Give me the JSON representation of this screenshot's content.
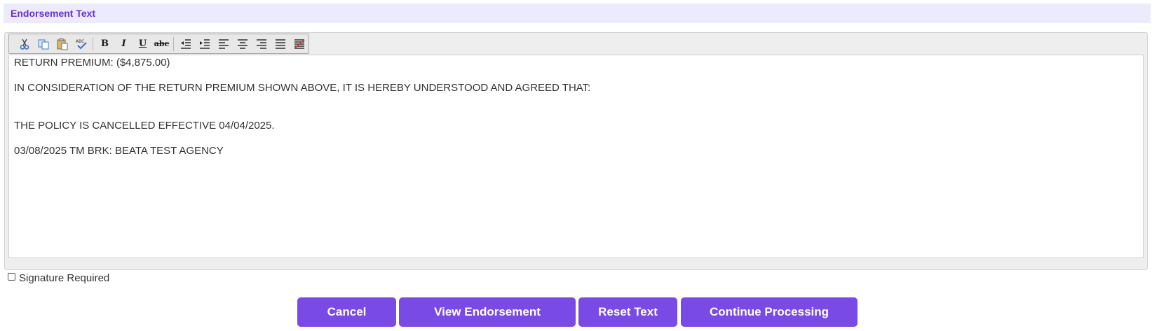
{
  "section": {
    "title": "Endorsement Text"
  },
  "toolbar": {
    "buttons": [
      {
        "name": "cut-icon",
        "glyph": ""
      },
      {
        "name": "copy-icon",
        "glyph": ""
      },
      {
        "name": "paste-icon",
        "glyph": ""
      },
      {
        "name": "spellcheck-icon",
        "glyph": ""
      },
      {
        "name": "bold-icon",
        "glyph": "B"
      },
      {
        "name": "italic-icon",
        "glyph": "I"
      },
      {
        "name": "underline-icon",
        "glyph": "U"
      },
      {
        "name": "strikethrough-icon",
        "glyph": "abc"
      },
      {
        "name": "outdent-icon",
        "glyph": ""
      },
      {
        "name": "indent-icon",
        "glyph": ""
      },
      {
        "name": "align-left-icon",
        "glyph": ""
      },
      {
        "name": "align-center-icon",
        "glyph": ""
      },
      {
        "name": "align-right-icon",
        "glyph": ""
      },
      {
        "name": "justify-icon",
        "glyph": ""
      },
      {
        "name": "text-color-icon",
        "glyph": ""
      }
    ]
  },
  "editor": {
    "lines": [
      "RETURN PREMIUM: ($4,875.00)",
      "IN CONSIDERATION OF THE RETURN PREMIUM SHOWN ABOVE, IT IS HEREBY UNDERSTOOD AND AGREED THAT:",
      "THE POLICY IS CANCELLED EFFECTIVE 04/04/2025.",
      "03/08/2025 TM BRK: BEATA TEST AGENCY"
    ]
  },
  "signature": {
    "label": "Signature Required",
    "checked": false
  },
  "actions": {
    "cancel": "Cancel",
    "view": "View Endorsement",
    "reset": "Reset Text",
    "continue": "Continue Processing"
  },
  "colors": {
    "accent": "#7a4ae6",
    "header_bg": "#ebebfd",
    "header_text": "#6a2fd6"
  }
}
